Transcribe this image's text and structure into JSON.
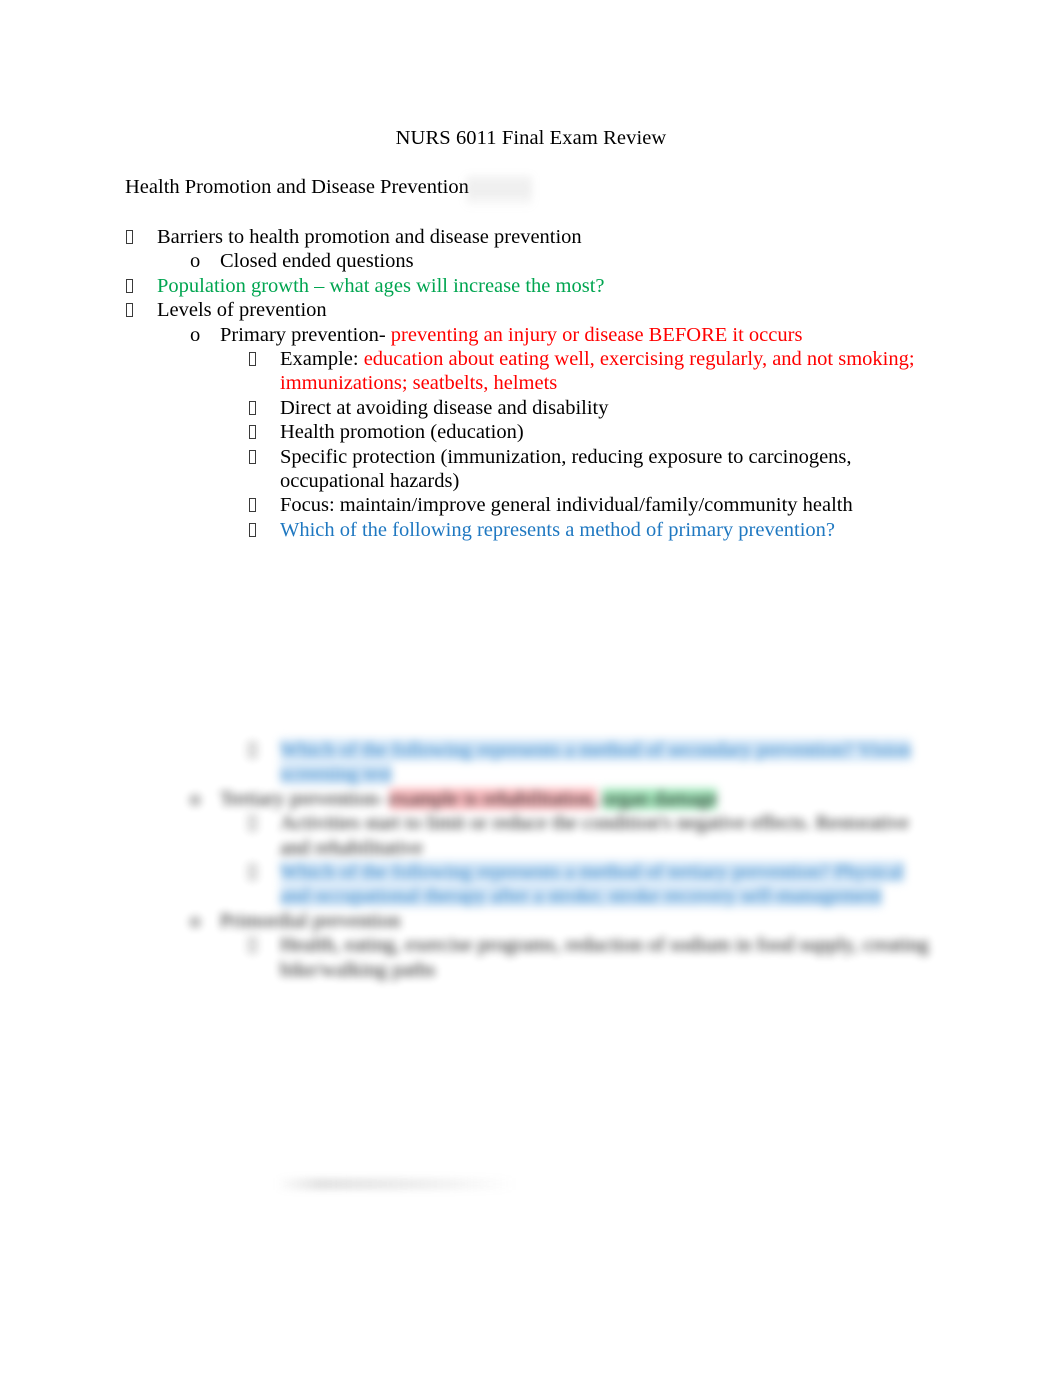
{
  "document": {
    "title": "NURS 6011 Final Exam Review",
    "section_heading": "Health Promotion and Disease Prevention"
  },
  "outline": {
    "items": [
      {
        "level": 1,
        "bullet": "tofu-box",
        "color": "black",
        "text": "Barriers to health promotion and disease prevention"
      },
      {
        "level": 2,
        "bullet": "o",
        "color": "black",
        "text": "Closed ended questions"
      },
      {
        "level": 1,
        "bullet": "tofu-box",
        "color": "green",
        "text": "Population growth – what ages will increase the most?"
      },
      {
        "level": 1,
        "bullet": "tofu-box",
        "color": "black",
        "text": "Levels of prevention"
      },
      {
        "level": 2,
        "bullet": "o",
        "color": "mixed",
        "text_black": "Primary prevention-",
        "text_red": "preventing an injury or disease BEFORE it occurs"
      },
      {
        "level": 3,
        "bullet": "tofu-box",
        "color": "mixed",
        "text_black": "Example:",
        "text_red": "education about eating well, exercising regularly, and not smoking; immunizations; seatbelts, helmets"
      },
      {
        "level": 3,
        "bullet": "tofu-box",
        "color": "black",
        "text": "Direct at avoiding disease and disability"
      },
      {
        "level": 3,
        "bullet": "tofu-box",
        "color": "black",
        "text": "Health promotion (education)"
      },
      {
        "level": 3,
        "bullet": "tofu-box",
        "color": "black",
        "text": "Specific protection (immunization, reducing exposure to carcinogens, occupational hazards)"
      },
      {
        "level": 3,
        "bullet": "tofu-box",
        "color": "black",
        "text": "Focus: maintain/improve general individual/family/community health"
      },
      {
        "level": 3,
        "bullet": "tofu-box",
        "color": "blue",
        "text": "Which of the following represents a method of primary prevention?"
      }
    ]
  },
  "redacted_region": {
    "note": "blurred / obscured content",
    "lines": [
      {
        "level": 3,
        "bullet": "tofu-box",
        "highlight": "blue",
        "text": "Which of the following represents a method of secondary prevention? Vision screening test"
      },
      {
        "level": 2,
        "bullet": "o",
        "highlight": "mixed",
        "text_black": "Tertiary prevention-",
        "text_red": "example is rehabilitation,",
        "text_green": "organ damage"
      },
      {
        "level": 3,
        "bullet": "tofu-box",
        "highlight": "none",
        "text": "Activities start to limit or reduce the condition's negative effects. Restorative and rehabilitative"
      },
      {
        "level": 3,
        "bullet": "tofu-box",
        "highlight": "blue",
        "text": "Which of the following represents a method of tertiary prevention? Physical and occupational therapy after a stroke; stroke recovery self-management"
      },
      {
        "level": 2,
        "bullet": "o",
        "highlight": "none",
        "text": "Primordial prevention"
      },
      {
        "level": 3,
        "bullet": "tofu-box",
        "highlight": "none",
        "text": "Health, eating, exercise programs, reduction of sodium in food supply, creating bike/walking paths"
      }
    ]
  },
  "colors": {
    "green": "#00a550",
    "red": "#ff0000",
    "blue": "#1f78c1",
    "black": "#000000",
    "highlight_blue": "#cfe4f7",
    "highlight_red": "#ffb9bd",
    "highlight_green": "#9fe8b9",
    "page_background": "#ffffff"
  }
}
